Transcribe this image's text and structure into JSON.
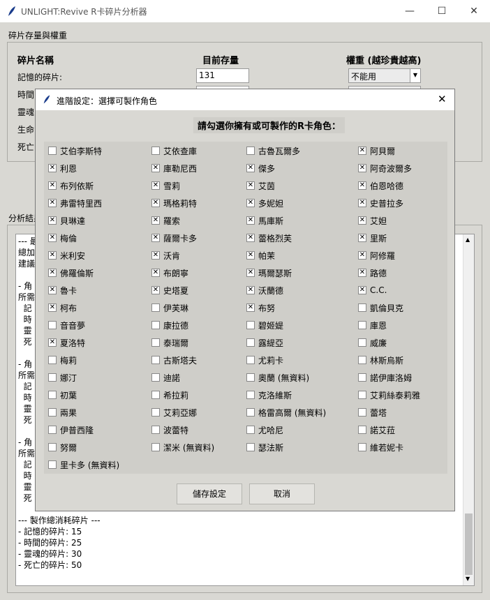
{
  "window": {
    "title": "UNLIGHT:Revive R卡碎片分析器",
    "minimize": "—",
    "maximize": "☐",
    "close": "✕"
  },
  "fragments": {
    "frame_title": "碎片存量與權重",
    "col_name": "碎片名稱",
    "col_stock": "目前存量",
    "col_weight": "權重 (越珍貴越高)",
    "rows": [
      {
        "label": "記憶的碎片:",
        "stock": "131",
        "weight": "不能用"
      },
      {
        "label": "時間",
        "stock": "",
        "weight": ""
      },
      {
        "label": "靈魂",
        "stock": "",
        "weight": ""
      },
      {
        "label": "生命",
        "stock": "",
        "weight": ""
      },
      {
        "label": "死亡",
        "stock": "",
        "weight": ""
      }
    ]
  },
  "analysis": {
    "frame_title": "分析結果",
    "lines": [
      "--- 最",
      "總加",
      "建議",
      "",
      "- 角",
      "所需",
      "  記",
      "  時",
      "  靈",
      "  死",
      "",
      "- 角",
      "所需",
      "  記",
      "  時",
      "  靈",
      "  死",
      "",
      "- 角",
      "所需",
      "  記",
      "  時",
      "  靈",
      "  死",
      "",
      "--- 製作總消耗碎片 ---",
      "- 記憶的碎片: 15",
      "- 時間的碎片: 25",
      "- 靈魂的碎片: 30",
      "- 死亡的碎片: 50"
    ]
  },
  "dialog": {
    "title": "進階設定：選擇可製作角色",
    "close": "✕",
    "heading": "請勾選你擁有或可製作的R卡角色：",
    "save_label": "儲存設定",
    "cancel_label": "取消",
    "columns": [
      [
        {
          "name": "艾伯李斯特",
          "checked": false
        },
        {
          "name": "利恩",
          "checked": true
        },
        {
          "name": "布列依斯",
          "checked": true
        },
        {
          "name": "弗雷特里西",
          "checked": true
        },
        {
          "name": "貝琳達",
          "checked": true
        },
        {
          "name": "梅倫",
          "checked": true
        },
        {
          "name": "米利安",
          "checked": true
        },
        {
          "name": "佛羅倫斯",
          "checked": true
        },
        {
          "name": "魯卡",
          "checked": true
        },
        {
          "name": "柯布",
          "checked": true
        },
        {
          "name": "音音夢",
          "checked": false
        },
        {
          "name": "夏洛特",
          "checked": true
        },
        {
          "name": "梅莉",
          "checked": false
        },
        {
          "name": "娜汀",
          "checked": false
        },
        {
          "name": "初葉",
          "checked": false
        },
        {
          "name": "兩果",
          "checked": false
        },
        {
          "name": "伊普西隆",
          "checked": false
        },
        {
          "name": "努爾",
          "checked": false
        },
        {
          "name": "里卡多 (無資料)",
          "checked": false
        }
      ],
      [
        {
          "name": "艾依查庫",
          "checked": false
        },
        {
          "name": "庫勒尼西",
          "checked": true
        },
        {
          "name": "雪莉",
          "checked": true
        },
        {
          "name": "瑪格莉特",
          "checked": true
        },
        {
          "name": "羅索",
          "checked": true
        },
        {
          "name": "薩爾卡多",
          "checked": true
        },
        {
          "name": "沃肯",
          "checked": true
        },
        {
          "name": "布朗寧",
          "checked": true
        },
        {
          "name": "史塔夏",
          "checked": true
        },
        {
          "name": "伊芙琳",
          "checked": false
        },
        {
          "name": "康拉德",
          "checked": false
        },
        {
          "name": "泰瑞爾",
          "checked": false
        },
        {
          "name": "古斯塔夫",
          "checked": false
        },
        {
          "name": "迪諾",
          "checked": false
        },
        {
          "name": "希拉莉",
          "checked": false
        },
        {
          "name": "艾莉亞娜",
          "checked": false
        },
        {
          "name": "波蕾特",
          "checked": false
        },
        {
          "name": "潔米 (無資料)",
          "checked": false
        }
      ],
      [
        {
          "name": "古魯瓦爾多",
          "checked": false
        },
        {
          "name": "傑多",
          "checked": true
        },
        {
          "name": "艾茵",
          "checked": true
        },
        {
          "name": "多妮妲",
          "checked": true
        },
        {
          "name": "馬庫斯",
          "checked": true
        },
        {
          "name": "蕾格烈芙",
          "checked": true
        },
        {
          "name": "帕茉",
          "checked": true
        },
        {
          "name": "瑪爾瑟斯",
          "checked": true
        },
        {
          "name": "沃蘭德",
          "checked": true
        },
        {
          "name": "布努",
          "checked": true
        },
        {
          "name": "碧姬媞",
          "checked": false
        },
        {
          "name": "露緹亞",
          "checked": false
        },
        {
          "name": "尤莉卡",
          "checked": false
        },
        {
          "name": "奧蘭 (無資料)",
          "checked": false
        },
        {
          "name": "克洛維斯",
          "checked": false
        },
        {
          "name": "格雷高爾 (無資料)",
          "checked": false
        },
        {
          "name": "尤哈尼",
          "checked": false
        },
        {
          "name": "瑟法斯",
          "checked": false
        }
      ],
      [
        {
          "name": "阿貝爾",
          "checked": true
        },
        {
          "name": "阿奇波爾多",
          "checked": true
        },
        {
          "name": "伯恩哈德",
          "checked": true
        },
        {
          "name": "史普拉多",
          "checked": true
        },
        {
          "name": "艾妲",
          "checked": true
        },
        {
          "name": "里斯",
          "checked": true
        },
        {
          "name": "阿修羅",
          "checked": true
        },
        {
          "name": "路德",
          "checked": true
        },
        {
          "name": "C.C.",
          "checked": true
        },
        {
          "name": "凱倫貝克",
          "checked": false
        },
        {
          "name": "庫恩",
          "checked": false
        },
        {
          "name": "威廉",
          "checked": false
        },
        {
          "name": "林斯烏斯",
          "checked": false
        },
        {
          "name": "諾伊庫洛姆",
          "checked": false
        },
        {
          "name": "艾莉絲泰莉雅",
          "checked": false
        },
        {
          "name": "蕾塔",
          "checked": false
        },
        {
          "name": "諾艾菈",
          "checked": false
        },
        {
          "name": "維若妮卡",
          "checked": false
        }
      ]
    ]
  }
}
